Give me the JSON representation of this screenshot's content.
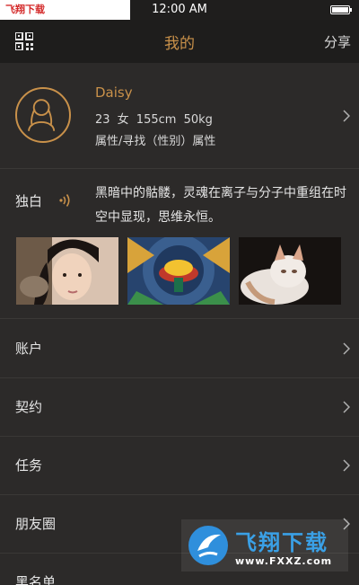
{
  "status_bar": {
    "watermark_tag": "飞翔下载 www.FXXZ.com",
    "time": "12:00 AM"
  },
  "nav": {
    "title": "我的",
    "share_label": "分享",
    "qr_icon": "qr-code-icon"
  },
  "profile": {
    "name": "Daisy",
    "stats": "23  女  155cm  50kg",
    "tags": "属性/寻找（性别）属性"
  },
  "soliloquy": {
    "label": "独白",
    "text": "黑暗中的骷髅，灵魂在离子与分子中重组在时空中显现，思维永恒。",
    "photos": [
      "photo-girl",
      "photo-beetle-art",
      "photo-cat"
    ]
  },
  "menu": [
    {
      "label": "账户"
    },
    {
      "label": "契约"
    },
    {
      "label": "任务"
    },
    {
      "label": "朋友圈"
    },
    {
      "label": "黑名单"
    }
  ],
  "watermark": {
    "title": "飞翔下载",
    "url": "www.FXXZ.com"
  },
  "colors": {
    "accent": "#c9914a",
    "background": "#2c2a29",
    "nav_bg": "#1e1d1c"
  }
}
